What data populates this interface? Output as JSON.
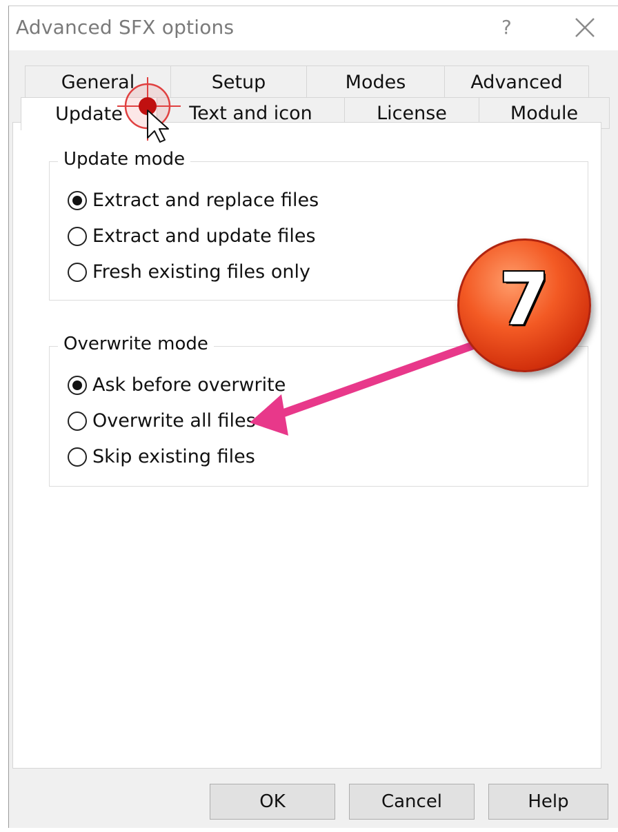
{
  "window": {
    "title": "Advanced SFX options",
    "help_label": "?",
    "close_icon": "close-icon"
  },
  "tabs": {
    "row1": [
      "General",
      "Setup",
      "Modes",
      "Advanced"
    ],
    "row2": [
      "Update",
      "Text and icon",
      "License",
      "Module"
    ],
    "active": "Update"
  },
  "update_mode": {
    "label": "Update mode",
    "options": [
      "Extract and replace files",
      "Extract and update files",
      "Fresh existing files only"
    ],
    "selected": "Extract and replace files"
  },
  "overwrite_mode": {
    "label": "Overwrite mode",
    "options": [
      "Ask before overwrite",
      "Overwrite all files",
      "Skip existing files"
    ],
    "selected": "Ask before overwrite"
  },
  "buttons": {
    "ok": "OK",
    "cancel": "Cancel",
    "help": "Help"
  },
  "annotation": {
    "step_number": "7",
    "badge_color": "#f35a24",
    "arrow_color": "#e8388a"
  },
  "cursor": {
    "icon": "click-target-icon"
  }
}
